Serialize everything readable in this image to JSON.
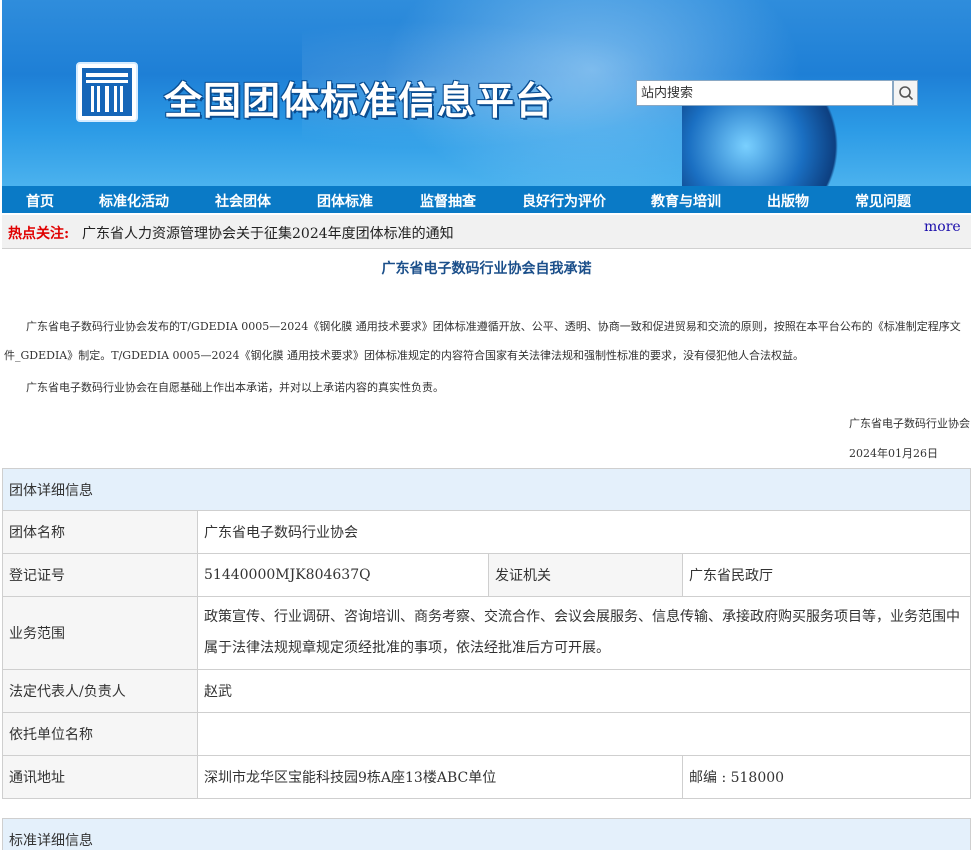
{
  "header": {
    "site_title": "全国团体标准信息平台",
    "search_placeholder": "站内搜索"
  },
  "nav": {
    "items": [
      "首页",
      "标准化活动",
      "社会团体",
      "团体标准",
      "监督抽查",
      "良好行为评价",
      "教育与培训",
      "出版物",
      "常见问题"
    ]
  },
  "hot": {
    "label": "热点关注:",
    "news": "广东省人力资源管理协会关于征集2024年度团体标准的通知",
    "more": "more"
  },
  "pledge": {
    "title": "广东省电子数码行业协会自我承诺",
    "para1": "　　广东省电子数码行业协会发布的T/GDEDIA 0005—2024《钢化膜 通用技术要求》团体标准遵循开放、公平、透明、协商一致和促进贸易和交流的原则，按照在本平台公布的《标准制定程序文件_GDEDIA》制定。T/GDEDIA 0005—2024《钢化膜 通用技术要求》团体标准规定的内容符合国家有关法律法规和强制性标准的要求，没有侵犯他人合法权益。",
    "para2": "　　广东省电子数码行业协会在自愿基础上作出本承诺，并对以上承诺内容的真实性负责。",
    "signer": "广东省电子数码行业协会",
    "date": "2024年01月26日"
  },
  "group_info": {
    "heading": "团体详细信息",
    "name_label": "团体名称",
    "name_value": "广东省电子数码行业协会",
    "reg_label": "登记证号",
    "reg_value": "51440000MJK804637Q",
    "issuer_label": "发证机关",
    "issuer_value": "广东省民政厅",
    "scope_label": "业务范围",
    "scope_value": "政策宣传、行业调研、咨询培训、商务考察、交流合作、会议会展服务、信息传输、承接政府购买服务项目等，业务范围中属于法律法规规章规定须经批准的事项，依法经批准后方可开展。",
    "rep_label": "法定代表人/负责人",
    "rep_value": "赵武",
    "unit_label": "依托单位名称",
    "unit_value": "",
    "addr_label": "通讯地址",
    "addr_value": "深圳市龙华区宝能科技园9栋A座13楼ABC单位",
    "zip_value": "邮编 : 518000"
  },
  "standard_info": {
    "heading": "标准详细信息"
  }
}
